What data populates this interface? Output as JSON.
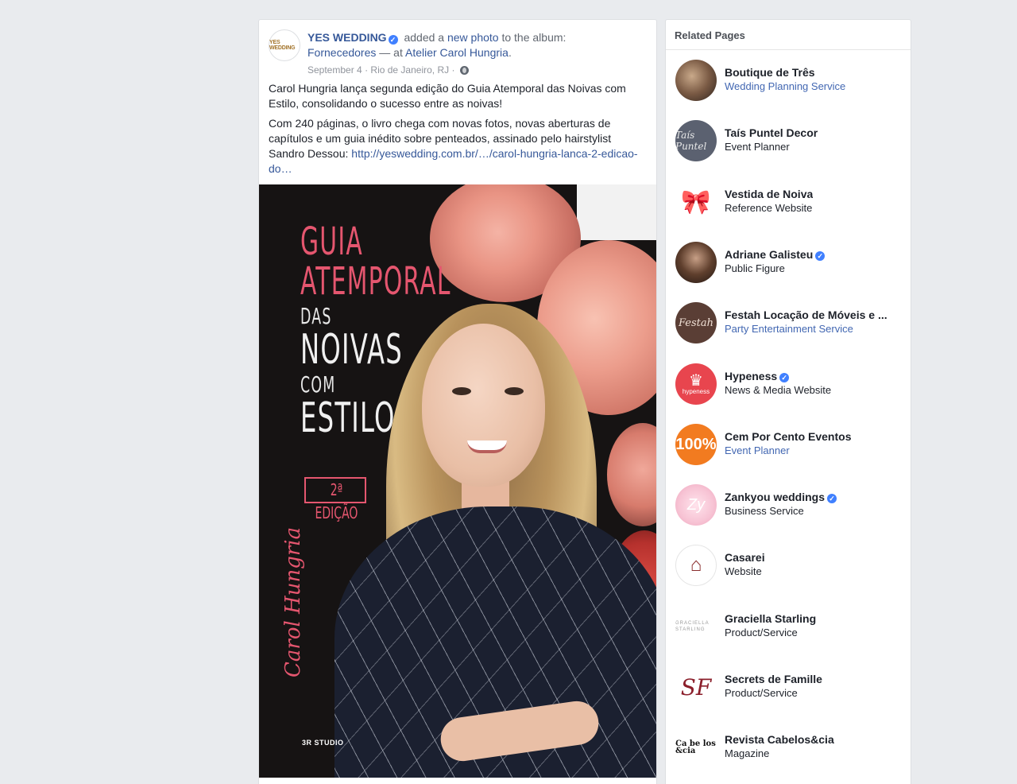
{
  "post": {
    "author": "YES WEDDING",
    "author_avatar_text": "YES WEDDING",
    "action_prefix": "added a",
    "action_link": "new photo",
    "action_suffix": "to the album:",
    "album": "Fornecedores",
    "at_text": "— at",
    "location_link": "Atelier Carol Hungria",
    "date": "September 4",
    "place": "Rio de Janeiro, RJ",
    "paragraph1": "Carol Hungria lança segunda edição do Guia Atemporal das Noivas com Estilo, consolidando o sucesso entre as noivas!",
    "paragraph2": "Com 240 páginas, o livro chega com novas fotos, novas aberturas de capítulos e um guia inédito sobre penteados, assinado pelo hairstylist Sandro Dessou:",
    "url": "http://yeswedding.com.br/…/carol-hungria-lanca-2-edicao-do…",
    "photo": {
      "line1": "GUIA",
      "line2": "ATEMPORAL",
      "line3": "DAS",
      "line4": "NOIVAS",
      "line5": "COM",
      "line6": "ESTILO",
      "edition": "2ª EDIÇÃO",
      "signature": "Carol Hungria",
      "studio": "3R STUDIO"
    }
  },
  "related": {
    "title": "Related Pages",
    "items": [
      {
        "name": "Boutique de Três",
        "category": "Wedding Planning Service",
        "category_link": true,
        "verified": false,
        "icon": "boutique-avatar"
      },
      {
        "name": "Taís Puntel Decor",
        "category": "Event Planner",
        "category_link": false,
        "verified": false,
        "icon": "tais-avatar",
        "avatar_text": "Taís Puntel"
      },
      {
        "name": "Vestida de Noiva",
        "category": "Reference Website",
        "category_link": false,
        "verified": false,
        "icon": "bow-icon"
      },
      {
        "name": "Adriane Galisteu",
        "category": "Public Figure",
        "category_link": false,
        "verified": true,
        "icon": "adriane-avatar"
      },
      {
        "name": "Festah Locação de Móveis e ...",
        "category": "Party Entertainment Service",
        "category_link": true,
        "verified": false,
        "icon": "festah-avatar",
        "avatar_text": "Festah"
      },
      {
        "name": "Hypeness",
        "category": "News & Media Website",
        "category_link": false,
        "verified": true,
        "icon": "crown-icon",
        "avatar_text": "hypeness"
      },
      {
        "name": "Cem Por Cento Eventos",
        "category": "Event Planner",
        "category_link": true,
        "verified": false,
        "icon": "cem-avatar",
        "avatar_text": "100%"
      },
      {
        "name": "Zankyou weddings",
        "category": "Business Service",
        "category_link": false,
        "verified": true,
        "icon": "zankyou-avatar",
        "avatar_text": "Zy"
      },
      {
        "name": "Casarei",
        "category": "Website",
        "category_link": false,
        "verified": false,
        "icon": "birdcage-icon"
      },
      {
        "name": "Graciella Starling",
        "category": "Product/Service",
        "category_link": false,
        "verified": false,
        "icon": "graciella-avatar",
        "avatar_text": "GRACIELLA STARLING"
      },
      {
        "name": "Secrets de Famille",
        "category": "Product/Service",
        "category_link": false,
        "verified": false,
        "icon": "sf-monogram-icon",
        "avatar_text": "SF"
      },
      {
        "name": "Revista Cabelos&cia",
        "category": "Magazine",
        "category_link": false,
        "verified": false,
        "icon": "revista-avatar",
        "avatar_text": "Ca be los &cia"
      }
    ]
  },
  "colors": {
    "page_bg": "#e9ebee",
    "link": "#365899",
    "category_link": "#4267b2",
    "verified": "#4080ff",
    "cover_pink": "#e5566f"
  }
}
